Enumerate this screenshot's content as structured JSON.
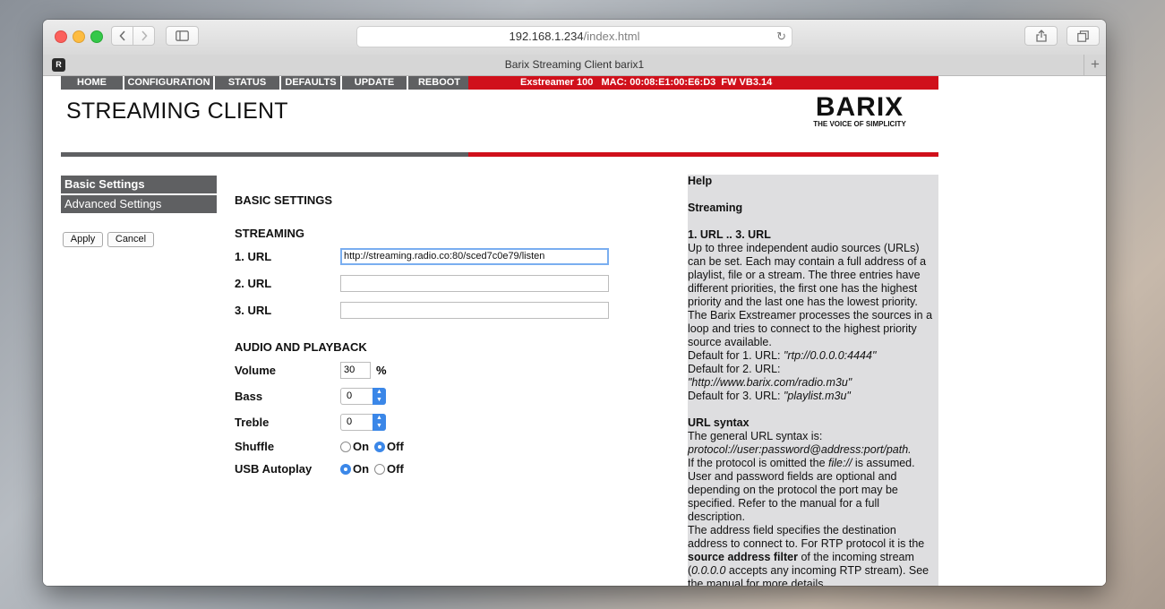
{
  "browser": {
    "url_host": "192.168.1.234",
    "url_path": "/index.html",
    "tab_title": "Barix Streaming Client barix1",
    "tab_icon_letter": "R"
  },
  "nav": {
    "items": [
      "HOME",
      "CONFIGURATION",
      "STATUS",
      "DEFAULTS",
      "UPDATE",
      "REBOOT"
    ],
    "device_info": "Exstreamer 100   MAC: 00:08:E1:00:E6:D3  FW VB3.14"
  },
  "header": {
    "title": "STREAMING CLIENT",
    "logo": "BARIX",
    "tagline": "THE VOICE OF SIMPLICITY"
  },
  "sidebar": {
    "items": [
      "Basic Settings",
      "Advanced Settings"
    ],
    "apply": "Apply",
    "cancel": "Cancel"
  },
  "form": {
    "heading": "BASIC SETTINGS",
    "streaming_heading": "STREAMING",
    "url1_label": "1. URL",
    "url1_value": "http://streaming.radio.co:80/sced7c0e79/listen",
    "url2_label": "2. URL",
    "url2_value": "",
    "url3_label": "3. URL",
    "url3_value": "",
    "audio_heading": "AUDIO AND PLAYBACK",
    "volume_label": "Volume",
    "volume_value": "30",
    "volume_unit": "%",
    "bass_label": "Bass",
    "bass_value": "0",
    "treble_label": "Treble",
    "treble_value": "0",
    "shuffle_label": "Shuffle",
    "shuffle_on": "On",
    "shuffle_off": "Off",
    "shuffle_selected": "Off",
    "usb_label": "USB Autoplay",
    "usb_on": "On",
    "usb_off": "Off",
    "usb_selected": "On"
  },
  "help": {
    "title": "Help",
    "section": "Streaming",
    "url_heading": "1. URL .. 3. URL",
    "url_text": "Up to three independent audio sources (URLs) can be set. Each may contain a full address of a playlist, file or a stream. The three entries have different priorities, the first one has the highest priority and the last one has the lowest priority. The Barix Exstreamer processes the sources in a loop and tries to connect to the highest priority source available.",
    "default1_prefix": "Default for 1. URL: ",
    "default1_value": "\"rtp://0.0.0.0:4444\"",
    "default2_prefix": "Default for 2. URL:",
    "default2_value": "\"http://www.barix.com/radio.m3u\"",
    "default3_prefix": "Default for 3. URL: ",
    "default3_value": "\"playlist.m3u\"",
    "syntax_heading": "URL syntax",
    "syntax_intro": "The general URL syntax is:",
    "syntax_example": "protocol://user:password@address:port/path.",
    "syntax_p1_a": "If the protocol is omitted the ",
    "syntax_p1_file": "file://",
    "syntax_p1_b": " is assumed. User and password fields are optional and depending on the protocol the port may be specified. Refer to the manual for a full description.",
    "syntax_p2_a": "The address field specifies the destination address to connect to. For RTP protocol it is the ",
    "syntax_p2_bold": "source address filter",
    "syntax_p2_b": " of the incoming stream (",
    "syntax_p2_ip": "0.0.0.0",
    "syntax_p2_c": " accepts any incoming RTP stream). See the manual for more details."
  }
}
